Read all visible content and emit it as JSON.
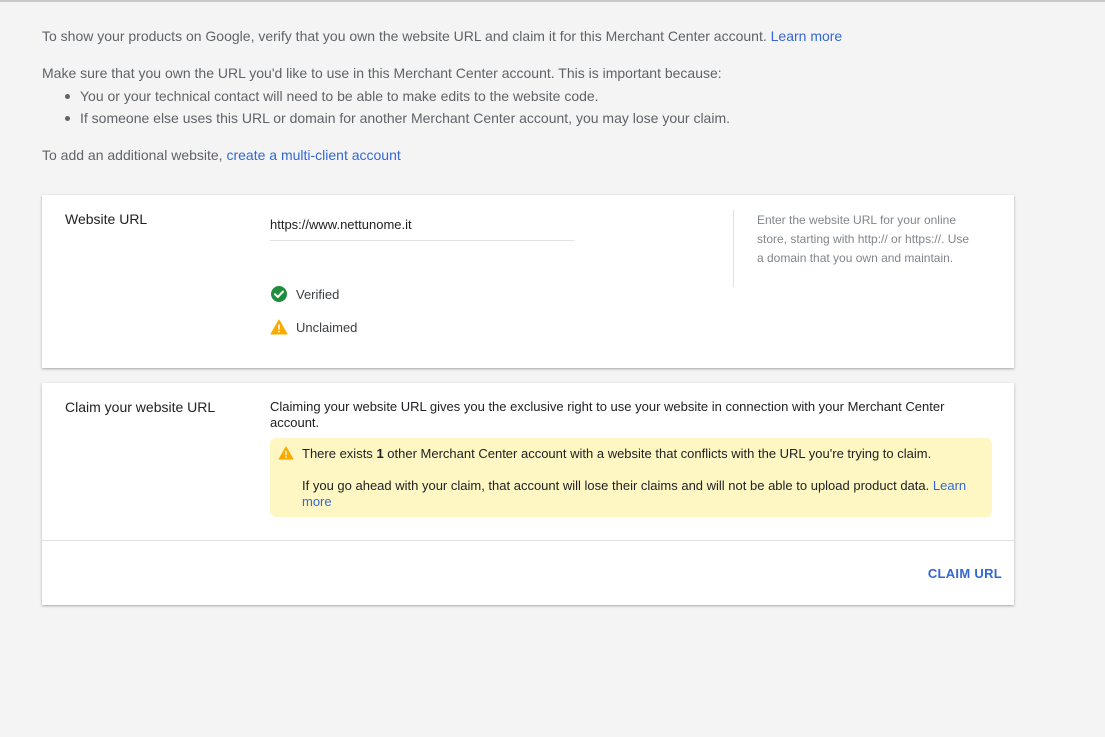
{
  "intro": {
    "line1": "To show your products on Google, verify that you own the website URL and claim it for this Merchant Center account.",
    "line1_link": "Learn more",
    "line2": "Make sure that you own the URL you'd like to use in this Merchant Center account. This is important because:",
    "bullets": [
      "You or your technical contact will need to be able to make edits to the website code.",
      "If someone else uses this URL or domain for another Merchant Center account, you may lose your claim."
    ],
    "line3": "To add an additional website,",
    "line3_link": "create a multi-client account"
  },
  "website_card": {
    "label": "Website URL",
    "url_value": "https://www.nettunome.it",
    "status_verified": "Verified",
    "status_unclaimed": "Unclaimed",
    "help_text": "Enter the website URL for your online store, starting with http:// or https://. Use a domain that you own and maintain."
  },
  "claim_card": {
    "label": "Claim your website URL",
    "description": "Claiming your website URL gives you the exclusive right to use your website in connection with your Merchant Center account.",
    "warning_pre": "There exists",
    "warning_count": "1",
    "warning_post": "other Merchant Center account with a website that conflicts with the URL you're trying to claim.",
    "warning_line2": "If you go ahead with your claim, that account will lose their claims and will not be able to upload product data.",
    "warning_link": "Learn more",
    "button_label": "CLAIM URL"
  },
  "colors": {
    "accent": "#3367d6",
    "verified": "#1e8e3e",
    "warning": "#f9ab00",
    "warning_bg": "#fef7c3"
  }
}
